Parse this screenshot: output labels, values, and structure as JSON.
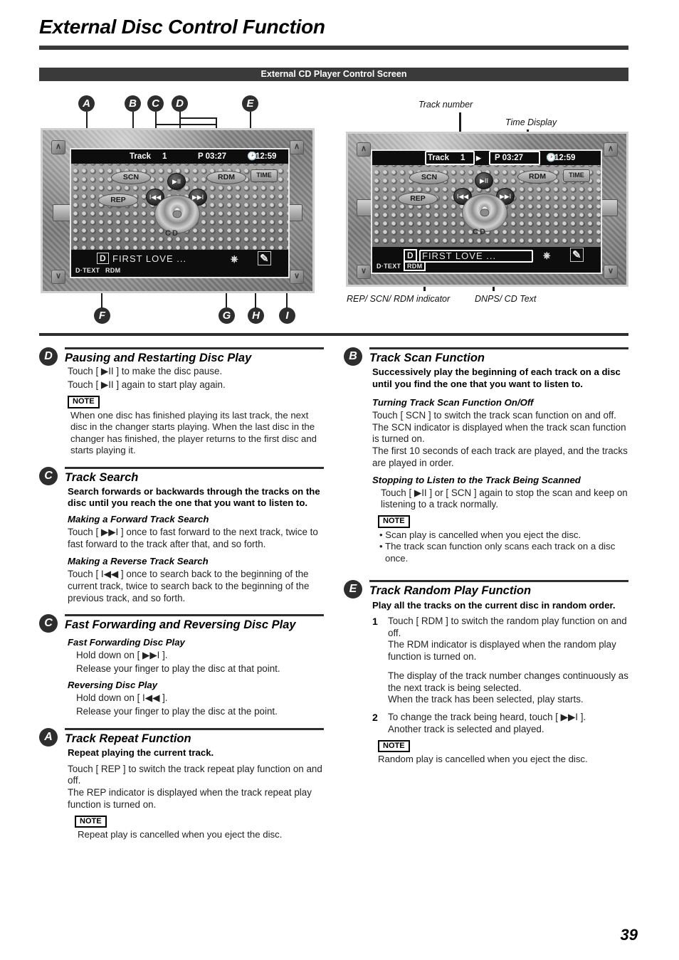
{
  "doc": {
    "title": "External Disc Control Function",
    "section_bar": "External CD Player Control Screen",
    "page_number": "39"
  },
  "diagram": {
    "markers_top": [
      "A",
      "B",
      "C",
      "D",
      "E"
    ],
    "markers_bottom": [
      "F",
      "G",
      "H",
      "I"
    ],
    "left_unit": {
      "track_label": "Track",
      "track_number": "1",
      "time_elapsed": "P 03:27",
      "clock": "12:59",
      "clock_icon": "clock-icon",
      "scn_button": "SCN",
      "rep_button": "REP",
      "rdm_button": "RDM",
      "time_button": "TIME",
      "play_pause_button": "▶II",
      "prev_button": "I◀◀",
      "next_button": "▶▶I",
      "disc_label": "CD",
      "disc_badge": "D",
      "dnps_text": "FIRST LOVE ...",
      "dtext_label": "D·TEXT",
      "rdm_indicator": "RDM",
      "corner_left_top": "∧",
      "corner_right_top": "∧",
      "corner_left_bottom": "∨",
      "corner_right_bottom": "∨",
      "radio_icon": "radio-icon",
      "tv_icon": "tv-icon",
      "eject_icon": "eject-icon",
      "pen_icon": "pen-icon"
    },
    "right_unit": {
      "track_label": "Track",
      "track_number": "1",
      "arrow": "▶",
      "time_elapsed": "P 03:27",
      "clock": "12:59",
      "scn_button": "SCN",
      "rep_button": "REP",
      "rdm_button": "RDM",
      "time_button": "TIME",
      "play_pause_button": "▶II",
      "prev_button": "I◀◀",
      "next_button": "▶▶I",
      "disc_label": "CD",
      "disc_badge": "D",
      "dnps_text": "FIRST LOVE ...",
      "dtext_label": "D·TEXT",
      "rdm_indicator": "RDM"
    },
    "captions": {
      "track_number": "Track  number",
      "time_display": "Time Display",
      "indicator": "REP/ SCN/ RDM indicator",
      "dnps": "DNPS/ CD Text"
    }
  },
  "left_column": [
    {
      "letter": "D",
      "title": "Pausing and Restarting Disc Play",
      "lines": [
        "Touch [ ▶II ] to make the disc pause.",
        "Touch [ ▶II ] again to start play again."
      ],
      "note_tag": "NOTE",
      "note": "When one disc has finished playing its last track, the next disc in the changer starts playing. When the last disc in the changer has finished, the player returns to the first disc and starts playing it."
    },
    {
      "letter": "C",
      "title": "Track Search",
      "intro_bold": "Search forwards or backwards through the tracks on the disc until you reach the one that you want to listen to.",
      "sub1": "Making a Forward Track Search",
      "sub1_body": "Touch [ ▶▶I ] once to fast forward to the next track, twice to fast forward to the track after that, and so forth.",
      "sub2": "Making a Reverse Track Search",
      "sub2_body": "Touch [ I◀◀ ]  once to search back to the beginning of the current track, twice to search back to the beginning of the previous track, and so forth."
    },
    {
      "letter": "C",
      "title": "Fast Forwarding and Reversing Disc Play",
      "sub1": "Fast Forwarding Disc Play",
      "sub1_l1": "Hold down on [ ▶▶I ].",
      "sub1_l2": "Release your finger to play the disc at that point.",
      "sub2": "Reversing Disc Play",
      "sub2_l1": "Hold down on [ I◀◀ ].",
      "sub2_l2": "Release your finger to play the disc at the point."
    },
    {
      "letter": "A",
      "title": "Track Repeat Function",
      "intro_bold": "Repeat playing the current track.",
      "body": "Touch [ REP ] to switch the track repeat play function on and off.\nThe REP indicator is displayed when the track repeat play function is turned on.",
      "note_tag": "NOTE",
      "note": "Repeat play is cancelled when you eject the disc."
    }
  ],
  "right_column": [
    {
      "letter": "B",
      "title": "Track Scan Function",
      "intro_bold": "Successively play the beginning of each track on a disc until you find the one that you want to listen to.",
      "sub1": "Turning Track Scan Function On/Off",
      "sub1_body": "Touch [ SCN ] to switch the track scan function on and off.\nThe SCN indicator is displayed when the track scan function is turned on.\nThe first 10 seconds of each track are played, and the tracks are played in order.",
      "sub2": "Stopping to Listen to the Track Being Scanned",
      "sub2_body": "Touch [ ▶II ] or [ SCN ] again to stop the scan and keep on listening to a track normally.",
      "note_tag": "NOTE",
      "bullets": [
        "• Scan play is cancelled when you eject the disc.",
        "• The track scan function only scans each track on a disc once."
      ]
    },
    {
      "letter": "E",
      "title": "Track Random Play Function",
      "intro_bold": "Play all the tracks on the current disc in random order.",
      "step1_num": "1",
      "step1_body": "Touch [ RDM ] to switch the random play function on and off.\nThe RDM indicator is displayed when the random   play function is turned on.",
      "step1_body2": "The display of the track number changes continuously as the next track is being selected.\nWhen the track has been selected, play starts.",
      "step2_num": "2",
      "step2_body": "To change the track being heard, touch [ ▶▶I ].\nAnother track is selected and played.",
      "note_tag": "NOTE",
      "note": "Random play is cancelled when you eject the disc."
    }
  ]
}
